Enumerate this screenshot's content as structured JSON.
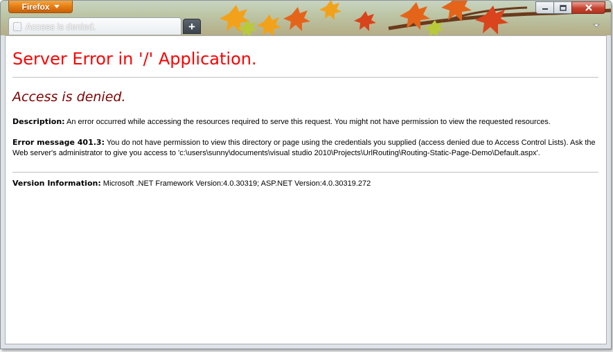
{
  "browser": {
    "menu_button": "Firefox",
    "tab_title": "Access is denied.",
    "new_tab_symbol": "+",
    "controls": {
      "minimize": "minimize",
      "maximize": "maximize",
      "close": "close"
    },
    "accent_color": "#e27a12"
  },
  "page": {
    "heading": "Server Error in '/' Application.",
    "subheading": "Access is denied.",
    "description_label": "Description:",
    "description_text": " An error occurred while accessing the resources required to serve this request. You might not have permission to view the requested resources.",
    "error_label": "Error message 401.3:",
    "error_text": " You do not have permission to view this directory or page using the credentials you supplied (access denied due to Access Control Lists). Ask the Web server's administrator to give you access to 'c:\\users\\sunny\\documents\\visual studio 2010\\Projects\\UrlRouting\\Routing-Static-Page-Demo\\Default.aspx'.",
    "version_label": "Version Information:",
    "version_text": " Microsoft .NET Framework Version:4.0.30319; ASP.NET Version:4.0.30319.272",
    "colors": {
      "heading": "#ff0000",
      "subheading": "#800000"
    }
  }
}
